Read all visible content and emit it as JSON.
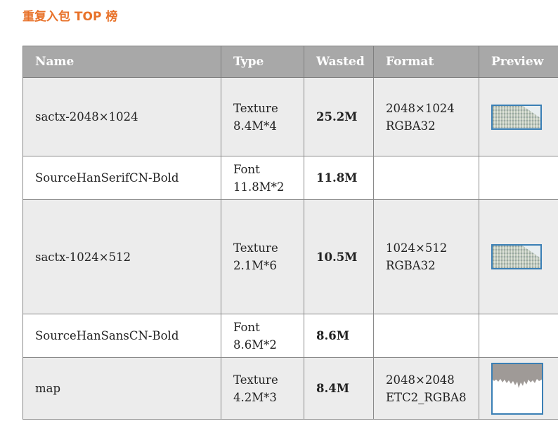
{
  "title": "重复入包 TOP 榜",
  "columns": [
    "Name",
    "Type",
    "Wasted",
    "Format",
    "Preview"
  ],
  "rows": [
    {
      "name": "sactx-2048×1024",
      "type": "Texture",
      "type_detail": "8.4M*4",
      "wasted": "25.2M",
      "format_size": "2048×1024",
      "format_kind": "RGBA32",
      "preview": "atlas-thumbnail"
    },
    {
      "name": "SourceHanSerifCN-Bold",
      "type": "Font",
      "type_detail": "11.8M*2",
      "wasted": "11.8M",
      "format_size": "",
      "format_kind": "",
      "preview": ""
    },
    {
      "name": "sactx-1024×512",
      "type": "Texture",
      "type_detail": "2.1M*6",
      "wasted": "10.5M",
      "format_size": "1024×512",
      "format_kind": "RGBA32",
      "preview": "atlas-thumbnail"
    },
    {
      "name": "SourceHanSansCN-Bold",
      "type": "Font",
      "type_detail": "8.6M*2",
      "wasted": "8.6M",
      "format_size": "",
      "format_kind": "",
      "preview": ""
    },
    {
      "name": "map",
      "type": "Texture",
      "type_detail": "4.2M*3",
      "wasted": "8.4M",
      "format_size": "2048×2048",
      "format_kind": "ETC2_RGBA8",
      "preview": "map-thumbnail"
    }
  ],
  "colors": {
    "title": "#e8722a",
    "header_bg": "#a8a8a8",
    "odd_row_bg": "#ececec",
    "preview_border": "#3a7fb5"
  }
}
